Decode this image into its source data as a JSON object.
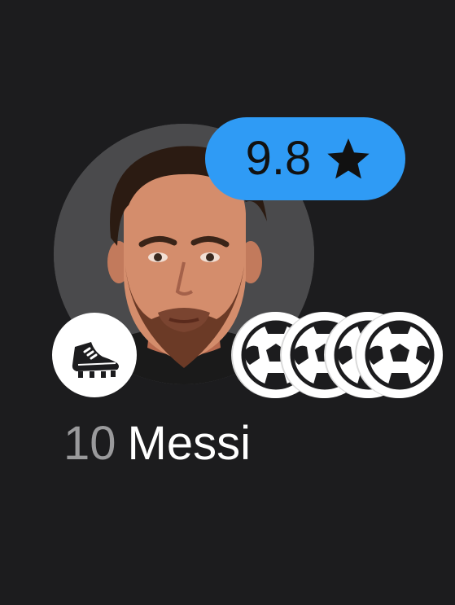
{
  "player": {
    "shirt_number": "10",
    "name": "Messi",
    "rating": "9.8"
  },
  "icons": {
    "rating": "star-icon",
    "boot": "football-boot-icon",
    "goal": "football-icon"
  },
  "goals": 4,
  "colors": {
    "background": "#1c1c1e",
    "rating_badge": "#2f9bf5",
    "avatar_bg": "#4a4a4c",
    "shirt_number": "#9a9a9c",
    "name": "#ffffff"
  }
}
